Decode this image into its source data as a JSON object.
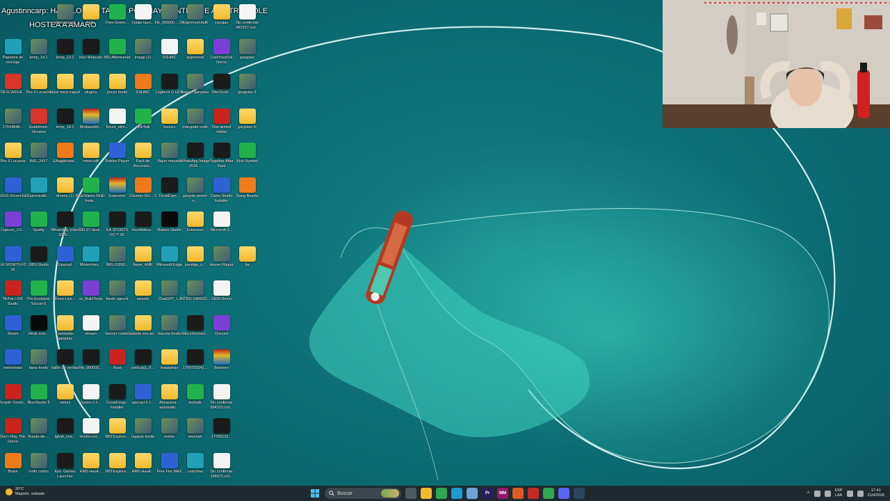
{
  "overlay": {
    "line1": "Agustinncarp: HACELO A LA TARDE POR HAY GENTE QUE A ENTRO COLE",
    "line2": "HOSTEA A AMARO"
  },
  "desktop_icons": [
    {
      "label": "elmmoncarp",
      "type": "img"
    },
    {
      "label": "Hola",
      "type": "folder"
    },
    {
      "label": "Free-Green...",
      "type": "green"
    },
    {
      "label": "hytale-laun...",
      "type": "doc"
    },
    {
      "label": "file_000000... (1)",
      "type": "img"
    },
    {
      "label": "Argenmod Auth",
      "type": "img"
    },
    {
      "label": "canujas",
      "type": "folder"
    },
    {
      "label": "Sin confirmar 462937.crd...",
      "type": "doc"
    },
    {
      "label": "Papelera de reciclaje",
      "type": "teal"
    },
    {
      "label": "temp_14.1",
      "type": "img"
    },
    {
      "label": "temp_13.1",
      "type": "dark"
    },
    {
      "label": "iriun Webcam",
      "type": "dark"
    },
    {
      "label": "MSI Afterburner",
      "type": "green"
    },
    {
      "label": "image (1)",
      "type": "img"
    },
    {
      "label": "DSHMC",
      "type": "doc"
    },
    {
      "label": "argenmod",
      "type": "folder"
    },
    {
      "label": "LockYourOut Demo",
      "type": "purple"
    },
    {
      "label": "gargolao",
      "type": "img"
    },
    {
      "label": "DESCARGA...",
      "type": "pdf"
    },
    {
      "label": "Pes 6 Locazos",
      "type": "folder"
    },
    {
      "label": "falyer para miguel",
      "type": "folder"
    },
    {
      "label": "plugins",
      "type": "folder"
    },
    {
      "label": "gncas fondo",
      "type": "folder"
    },
    {
      "label": "DSHMC",
      "type": "orange"
    },
    {
      "label": "Logitech G HUB",
      "type": "dark"
    },
    {
      "label": "banejo gargolas",
      "type": "img"
    },
    {
      "label": "34ecSczb...",
      "type": "dark"
    },
    {
      "label": "gargolao 2",
      "type": "img"
    },
    {
      "label": "17644848...",
      "type": "img"
    },
    {
      "label": "Guidelines-Streams",
      "type": "pdf"
    },
    {
      "label": "temp_18.1",
      "type": "dark"
    },
    {
      "label": "ModpackM...",
      "type": "zip"
    },
    {
      "label": "future_elim...",
      "type": "doc"
    },
    {
      "label": "KickTalk",
      "type": "green"
    },
    {
      "label": "basura",
      "type": "folder"
    },
    {
      "label": "marupaid code",
      "type": "img"
    },
    {
      "label": "One-armed robber",
      "type": "red"
    },
    {
      "label": "gargolao fc",
      "type": "folder"
    },
    {
      "label": "Pes 6 Locazos",
      "type": "folder"
    },
    {
      "label": "IMG_2417",
      "type": "img"
    },
    {
      "label": "EAappInstal...",
      "type": "orange"
    },
    {
      "label": "minecraft",
      "type": "folder"
    },
    {
      "label": "Roblox Player",
      "type": "app"
    },
    {
      "label": "Pack de Recursos...",
      "type": "folder"
    },
    {
      "label": "flayer maceta",
      "type": "img"
    },
    {
      "label": "WhatsApp Image 2026...",
      "type": "dark"
    },
    {
      "label": "Together After Dark",
      "type": "dark"
    },
    {
      "label": "Kick-Symbol",
      "type": "green"
    },
    {
      "label": "ASUS DriverHub",
      "type": "app"
    },
    {
      "label": "EpicInstalle...",
      "type": "teal"
    },
    {
      "label": "drivers (1)",
      "type": "folder"
    },
    {
      "label": "BlueStacks Multi-Insta...",
      "type": "green"
    },
    {
      "label": "Extension",
      "type": "zip"
    },
    {
      "label": "Counter-Stri... 2",
      "type": "orange"
    },
    {
      "label": "DroidCam...",
      "type": "dark"
    },
    {
      "label": "gargola primer e...",
      "type": "img"
    },
    {
      "label": "Camo Studio Installer",
      "type": "app"
    },
    {
      "label": "Gang Beasts",
      "type": "orange"
    },
    {
      "label": "Capture_2.0...",
      "type": "purple"
    },
    {
      "label": "Spotify",
      "type": "green"
    },
    {
      "label": "WhatsApp Video 2025-...",
      "type": "dark"
    },
    {
      "label": "580.97-desk...",
      "type": "green"
    },
    {
      "label": "EA SPORTS FC™ 26",
      "type": "dark"
    },
    {
      "label": "iriunWebca...",
      "type": "dark"
    },
    {
      "label": "Roblox Studio",
      "type": "black"
    },
    {
      "label": "Extension",
      "type": "folder"
    },
    {
      "label": "Microsoft.S...",
      "type": "doc"
    },
    {
      "label": "EA SPORTS FC 26",
      "type": "app"
    },
    {
      "label": "OBS Studio",
      "type": "dark"
    },
    {
      "label": "Upscayl",
      "type": "app"
    },
    {
      "label": "MisterHors...",
      "type": "teal"
    },
    {
      "label": "IMG-20260...",
      "type": "img"
    },
    {
      "label": "flayer_AME",
      "type": "folder"
    },
    {
      "label": "Microsoft Edge",
      "type": "teal"
    },
    {
      "label": "prestige_ii...",
      "type": "folder"
    },
    {
      "label": "House Flipper",
      "type": "img"
    },
    {
      "label": "Ita",
      "type": "folder"
    },
    {
      "label": "TikTok LIVE Studio",
      "type": "red"
    },
    {
      "label": "Pro Evolution Soccer 6",
      "type": "green"
    },
    {
      "label": "Deep-Live...",
      "type": "folder"
    },
    {
      "label": "vs_BuildTools",
      "type": "purple"
    },
    {
      "label": "fondo agruck",
      "type": "img"
    },
    {
      "label": "awards",
      "type": "folder"
    },
    {
      "label": "ChatGPT_I...",
      "type": "img"
    },
    {
      "label": "INTRO GARGO...",
      "type": "img"
    },
    {
      "label": "VEIN Demo",
      "type": "doc"
    },
    {
      "label": "Steam",
      "type": "app"
    },
    {
      "label": "tiktok-icon...",
      "type": "black"
    },
    {
      "label": "camisetas gargolas",
      "type": "folder"
    },
    {
      "label": "stream",
      "type": "doc"
    },
    {
      "label": "banner roobet",
      "type": "img"
    },
    {
      "label": "awards sss.ae...",
      "type": "folder"
    },
    {
      "label": "maceta fondo",
      "type": "img"
    },
    {
      "label": "Más informaci...",
      "type": "dark"
    },
    {
      "label": "Discord",
      "type": "purple"
    },
    {
      "label": "entrevistas",
      "type": "app"
    },
    {
      "label": "bana fondo",
      "type": "img"
    },
    {
      "label": "ballin de verdad",
      "type": "dark"
    },
    {
      "label": "file_000000...",
      "type": "dark"
    },
    {
      "label": "Rust",
      "type": "red"
    },
    {
      "label": "pelicula1_9...",
      "type": "dark"
    },
    {
      "label": "mapashax",
      "type": "folder"
    },
    {
      "label": "1769759342...",
      "type": "dark"
    },
    {
      "label": "Banners",
      "type": "zip"
    },
    {
      "label": "Burglin' Gnom...",
      "type": "red"
    },
    {
      "label": "BlueStacks 5",
      "type": "green"
    },
    {
      "label": "remini",
      "type": "folder"
    },
    {
      "label": "fusion-1.2...",
      "type": "doc"
    },
    {
      "label": "CurseForge - Installer",
      "type": "dark"
    },
    {
      "label": "upscayl-2.1...",
      "type": "app"
    },
    {
      "label": "Almacena... automatic...",
      "type": "folder"
    },
    {
      "label": "kicktalk",
      "type": "green"
    },
    {
      "label": "Sin confirmar 894333.crd...",
      "type": "doc"
    },
    {
      "label": "Don't Play This Demo",
      "type": "red"
    },
    {
      "label": "Rueda-de-...",
      "type": "img"
    },
    {
      "label": "lghub_inst...",
      "type": "dark"
    },
    {
      "label": "reinforced_...",
      "type": "doc"
    },
    {
      "label": "NBTExplore...",
      "type": "folder"
    },
    {
      "label": "ragaylo fondo",
      "type": "img"
    },
    {
      "label": "momo",
      "type": "img"
    },
    {
      "label": "memuel",
      "type": "img"
    },
    {
      "label": "17705102...",
      "type": "dark"
    },
    {
      "label": "Brave",
      "type": "orange"
    },
    {
      "label": "mofo cstrtrs",
      "type": "img"
    },
    {
      "label": "Epic Games Launcher",
      "type": "dark"
    },
    {
      "label": "HMS.HaxA...",
      "type": "folder"
    },
    {
      "label": "NBTExplore...",
      "type": "folder"
    },
    {
      "label": "HMS.HaxA...",
      "type": "folder"
    },
    {
      "label": "Free Fire MAX",
      "type": "app"
    },
    {
      "label": "LetsView",
      "type": "teal"
    },
    {
      "label": "Sin confirmar 336672.crd...",
      "type": "doc"
    }
  ],
  "taskbar": {
    "weather_temp": "20°C",
    "weather_desc": "Mayorm. soleado",
    "search_placeholder": "Buscar",
    "apps": [
      {
        "name": "task-view",
        "color": "#4b5a62",
        "text": ""
      },
      {
        "name": "file-explorer",
        "color": "#f2b92b",
        "text": ""
      },
      {
        "name": "chrome",
        "color": "#2fa84f",
        "text": ""
      },
      {
        "name": "edge",
        "color": "#1f9bd1",
        "text": ""
      },
      {
        "name": "notepad",
        "color": "#6aa4d8",
        "text": ""
      },
      {
        "name": "premiere",
        "color": "#2a1f5a",
        "text": "Pr"
      },
      {
        "name": "mpc",
        "color": "#8e1a6d",
        "text": "MM"
      },
      {
        "name": "brave",
        "color": "#e05a23",
        "text": ""
      },
      {
        "name": "app-red",
        "color": "#c72a25",
        "text": ""
      },
      {
        "name": "chrome-2",
        "color": "#2fa84f",
        "text": ""
      },
      {
        "name": "discord",
        "color": "#5865f2",
        "text": ""
      },
      {
        "name": "steam",
        "color": "#2a475e",
        "text": ""
      }
    ],
    "lang_top": "ESP",
    "lang_bottom": "LAA",
    "time": "17:41",
    "date": "21/4/2026"
  }
}
